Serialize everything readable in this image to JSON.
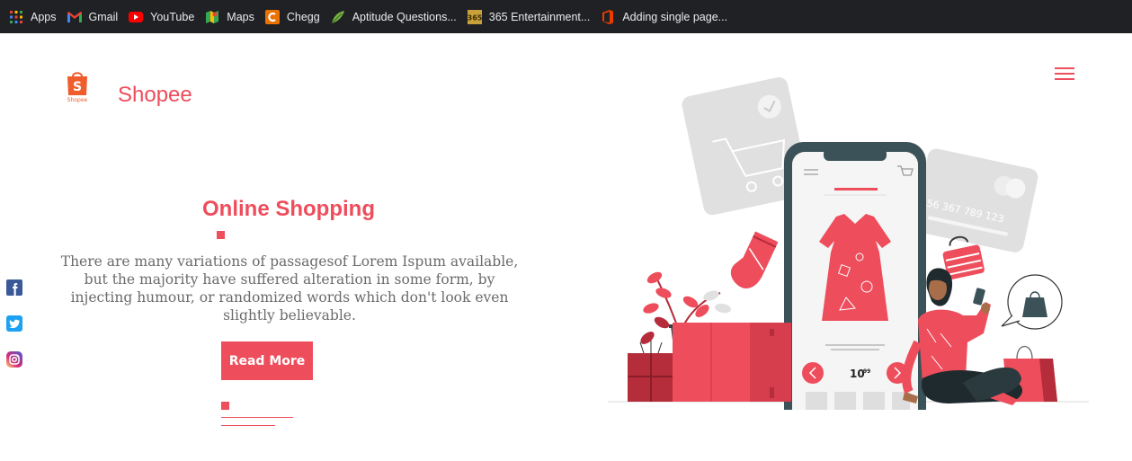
{
  "bookmarks": [
    {
      "label": "Apps",
      "icon": "apps-grid-icon"
    },
    {
      "label": "Gmail",
      "icon": "gmail-icon"
    },
    {
      "label": "YouTube",
      "icon": "youtube-icon"
    },
    {
      "label": "Maps",
      "icon": "maps-icon"
    },
    {
      "label": "Chegg",
      "icon": "chegg-icon"
    },
    {
      "label": "Aptitude Questions...",
      "icon": "leaf-icon"
    },
    {
      "label": "365 Entertainment...",
      "icon": "365-icon"
    },
    {
      "label": "Adding single page...",
      "icon": "office-icon"
    }
  ],
  "header": {
    "brand": "Shopee",
    "logo_text": "S",
    "logo_caption": "Shopee"
  },
  "hero": {
    "title": "Online Shopping",
    "text": "There are many variations of passagesof Lorem Ispum available, but the majority have suffered alteration in some form, by injecting humour, or randomized words which don't look even slightly believable.",
    "button": "Read More"
  },
  "illustration": {
    "card_number": "56 367 789 123",
    "price": "10",
    "price_cents": "99"
  },
  "colors": {
    "accent": "#ee4d5c",
    "bookmarks_bg": "#202124",
    "phone_frame": "#3b5259"
  }
}
